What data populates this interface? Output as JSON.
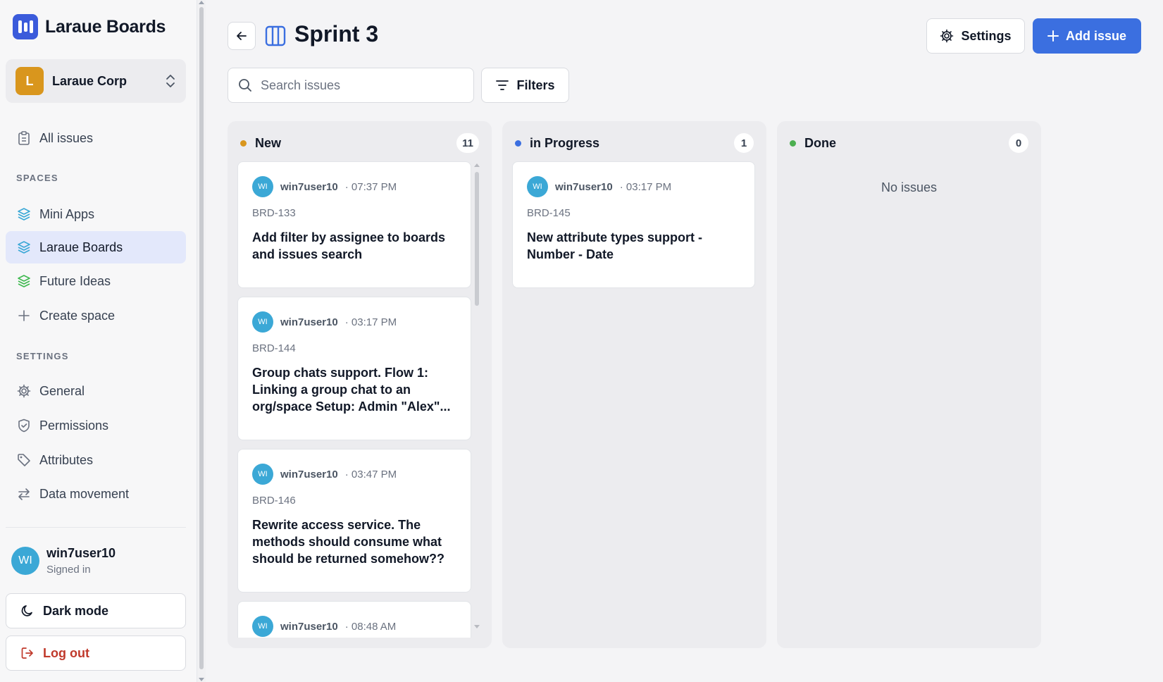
{
  "sidebar": {
    "brand_title": "Laraue Boards",
    "org": {
      "initial": "L",
      "name": "Laraue Corp",
      "color": "#d9961d"
    },
    "all_issues_label": "All issues",
    "spaces_heading": "SPACES",
    "spaces": [
      {
        "label": "Mini Apps",
        "icon": "layers-icon",
        "color": "#3ba8d6"
      },
      {
        "label": "Laraue Boards",
        "icon": "layers-icon",
        "color": "#3ba8d6",
        "active": true
      },
      {
        "label": "Future Ideas",
        "icon": "layers-icon",
        "color": "#3fb950"
      }
    ],
    "create_space_label": "Create space",
    "settings_heading": "SETTINGS",
    "settings": [
      {
        "label": "General",
        "icon": "gear-icon"
      },
      {
        "label": "Permissions",
        "icon": "shield-icon"
      },
      {
        "label": "Attributes",
        "icon": "tag-icon"
      },
      {
        "label": "Data movement",
        "icon": "arrows-icon"
      }
    ],
    "user": {
      "initials": "WI",
      "name": "win7user10",
      "status": "Signed in"
    },
    "dark_mode_label": "Dark mode",
    "logout_label": "Log out"
  },
  "header": {
    "title": "Sprint 3",
    "settings_label": "Settings",
    "add_issue_label": "Add issue"
  },
  "toolbar": {
    "search_placeholder": "Search issues",
    "filters_label": "Filters"
  },
  "columns": [
    {
      "title": "New",
      "count": "11",
      "dot_color": "#d9961d",
      "cards": [
        {
          "initials": "WI",
          "user": "win7user10",
          "time": "· 07:37 PM",
          "key": "BRD-133",
          "title": "Add filter by assignee to boards and issues search"
        },
        {
          "initials": "WI",
          "user": "win7user10",
          "time": "· 03:17 PM",
          "key": "BRD-144",
          "title": "Group chats support. Flow 1: Linking a group chat to an org/space Setup: Admin \"Alex\"..."
        },
        {
          "initials": "WI",
          "user": "win7user10",
          "time": "· 03:47 PM",
          "key": "BRD-146",
          "title": "Rewrite access service. The methods should consume what should be returned somehow??"
        },
        {
          "initials": "WI",
          "user": "win7user10",
          "time": "· 08:48 AM",
          "key": "",
          "title": ""
        }
      ]
    },
    {
      "title": "in Progress",
      "count": "1",
      "dot_color": "#3b6fe0",
      "cards": [
        {
          "initials": "WI",
          "user": "win7user10",
          "time": "· 03:17 PM",
          "key": "BRD-145",
          "title": "New attribute types support - Number - Date"
        }
      ]
    },
    {
      "title": "Done",
      "count": "0",
      "dot_color": "#4caf50",
      "empty_label": "No issues",
      "cards": []
    }
  ]
}
